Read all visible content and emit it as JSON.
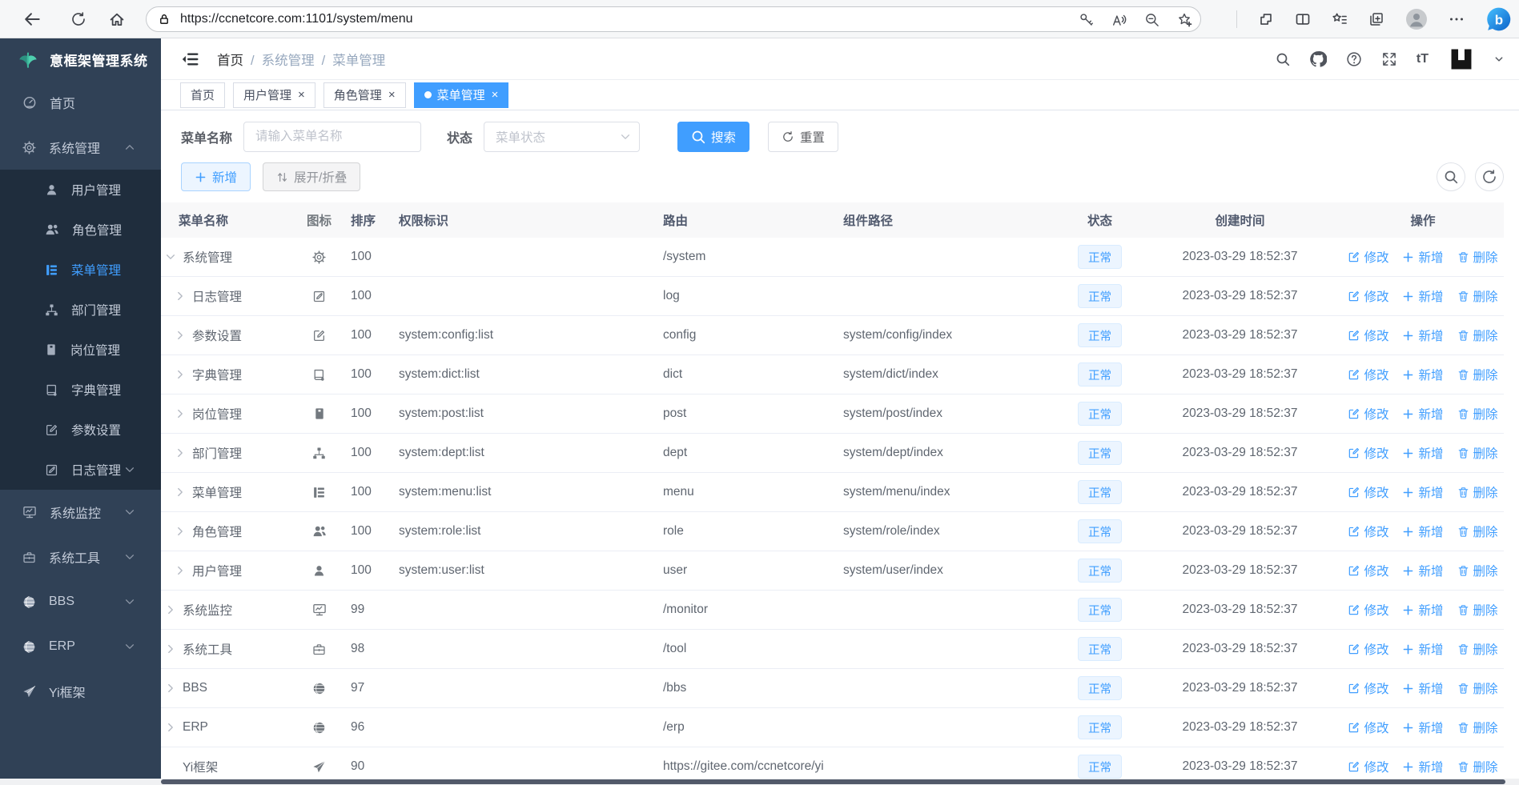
{
  "colors": {
    "accent": "#409eff",
    "sidebar_bg": "#304156",
    "submenu_bg": "#1f2d3d",
    "tag_bg": "#ecf5ff",
    "tab_active_bg": "#409eff",
    "logo_green": "#3fbf9c"
  },
  "browser": {
    "url": "https://ccnetcore.com:1101/system/menu",
    "left_icons": [
      "back-icon",
      "refresh-icon",
      "home-icon"
    ],
    "pill_left_icon": "lock-icon",
    "pill_right_icons": [
      "key-icon",
      "read-aloud-icon",
      "zoom-out-icon",
      "favorite-add-icon"
    ],
    "right_icons": [
      "extensions-icon",
      "split-screen-icon",
      "favorites-bar-icon",
      "collections-icon",
      "profile-icon",
      "more-icon",
      "bing-icon"
    ]
  },
  "sidebar": {
    "logo_text": "意框架管理系统",
    "logo_icon": "leaf-logo-icon",
    "items": [
      {
        "label": "首页",
        "icon": "dashboard-icon",
        "caret": null,
        "active": false
      },
      {
        "label": "系统管理",
        "icon": "gear-icon",
        "caret": "chevron-up-icon",
        "active": false,
        "children": [
          {
            "label": "用户管理",
            "icon": "user-icon",
            "caret": null,
            "active": false
          },
          {
            "label": "角色管理",
            "icon": "role-icon",
            "caret": null,
            "active": false
          },
          {
            "label": "菜单管理",
            "icon": "menu-icon",
            "caret": null,
            "active": true
          },
          {
            "label": "部门管理",
            "icon": "dept-icon",
            "caret": null,
            "active": false
          },
          {
            "label": "岗位管理",
            "icon": "post-icon",
            "caret": null,
            "active": false
          },
          {
            "label": "字典管理",
            "icon": "dict-icon",
            "caret": null,
            "active": false
          },
          {
            "label": "参数设置",
            "icon": "config-icon",
            "caret": null,
            "active": false
          },
          {
            "label": "日志管理",
            "icon": "log-icon",
            "caret": "chevron-down-icon",
            "active": false
          }
        ]
      },
      {
        "label": "系统监控",
        "icon": "monitor-icon",
        "caret": "chevron-down-icon",
        "active": false
      },
      {
        "label": "系统工具",
        "icon": "tool-icon",
        "caret": "chevron-down-icon",
        "active": false
      },
      {
        "label": "BBS",
        "icon": "globe-icon",
        "caret": "chevron-down-icon",
        "active": false
      },
      {
        "label": "ERP",
        "icon": "globe-icon",
        "caret": "chevron-down-icon",
        "active": false
      },
      {
        "label": "Yi框架",
        "icon": "plane-icon",
        "caret": null,
        "active": false
      }
    ]
  },
  "header": {
    "breadcrumb": [
      "首页",
      "系统管理",
      "菜单管理"
    ],
    "action_icons": [
      "search-icon",
      "github-icon",
      "help-icon",
      "fullscreen-icon",
      "font-size-icon"
    ],
    "avatar_icon": "user-avatar-logo-icon",
    "avatar_caret": "caret-down-icon"
  },
  "tabs": [
    {
      "label": "首页",
      "closable": false,
      "active": false
    },
    {
      "label": "用户管理",
      "closable": true,
      "active": false
    },
    {
      "label": "角色管理",
      "closable": true,
      "active": false
    },
    {
      "label": "菜单管理",
      "closable": true,
      "active": true
    }
  ],
  "filters": {
    "name_label": "菜单名称",
    "name_placeholder": "请输入菜单名称",
    "name_value": "",
    "status_label": "状态",
    "status_placeholder": "菜单状态",
    "search_label": "搜索",
    "reset_label": "重置"
  },
  "toolbar": {
    "add_label": "新增",
    "expand_label": "展开/折叠"
  },
  "table": {
    "columns": [
      "菜单名称",
      "图标",
      "排序",
      "权限标识",
      "路由",
      "组件路径",
      "状态",
      "创建时间",
      "操作"
    ],
    "op_labels": [
      "修改",
      "新增",
      "删除"
    ],
    "op_icons": [
      "edit-icon",
      "plus-icon",
      "trash-icon"
    ],
    "rows": [
      {
        "name": "系统管理",
        "icon": "gear-icon",
        "level": 0,
        "expand": "expanded",
        "sort": "100",
        "perm": "",
        "route": "/system",
        "component": "",
        "status": "正常",
        "created": "2023-03-29 18:52:37"
      },
      {
        "name": "日志管理",
        "icon": "log-icon",
        "level": 1,
        "expand": "collapsed",
        "sort": "100",
        "perm": "",
        "route": "log",
        "component": "",
        "status": "正常",
        "created": "2023-03-29 18:52:37"
      },
      {
        "name": "参数设置",
        "icon": "config-icon",
        "level": 1,
        "expand": "collapsed",
        "sort": "100",
        "perm": "system:config:list",
        "route": "config",
        "component": "system/config/index",
        "status": "正常",
        "created": "2023-03-29 18:52:37"
      },
      {
        "name": "字典管理",
        "icon": "dict-icon",
        "level": 1,
        "expand": "collapsed",
        "sort": "100",
        "perm": "system:dict:list",
        "route": "dict",
        "component": "system/dict/index",
        "status": "正常",
        "created": "2023-03-29 18:52:37"
      },
      {
        "name": "岗位管理",
        "icon": "post-icon",
        "level": 1,
        "expand": "collapsed",
        "sort": "100",
        "perm": "system:post:list",
        "route": "post",
        "component": "system/post/index",
        "status": "正常",
        "created": "2023-03-29 18:52:37"
      },
      {
        "name": "部门管理",
        "icon": "dept-icon",
        "level": 1,
        "expand": "collapsed",
        "sort": "100",
        "perm": "system:dept:list",
        "route": "dept",
        "component": "system/dept/index",
        "status": "正常",
        "created": "2023-03-29 18:52:37"
      },
      {
        "name": "菜单管理",
        "icon": "menu-icon",
        "level": 1,
        "expand": "collapsed",
        "sort": "100",
        "perm": "system:menu:list",
        "route": "menu",
        "component": "system/menu/index",
        "status": "正常",
        "created": "2023-03-29 18:52:37"
      },
      {
        "name": "角色管理",
        "icon": "role-icon",
        "level": 1,
        "expand": "collapsed",
        "sort": "100",
        "perm": "system:role:list",
        "route": "role",
        "component": "system/role/index",
        "status": "正常",
        "created": "2023-03-29 18:52:37"
      },
      {
        "name": "用户管理",
        "icon": "user-icon",
        "level": 1,
        "expand": "collapsed",
        "sort": "100",
        "perm": "system:user:list",
        "route": "user",
        "component": "system/user/index",
        "status": "正常",
        "created": "2023-03-29 18:52:37"
      },
      {
        "name": "系统监控",
        "icon": "monitor-icon",
        "level": 0,
        "expand": "collapsed",
        "sort": "99",
        "perm": "",
        "route": "/monitor",
        "component": "",
        "status": "正常",
        "created": "2023-03-29 18:52:37"
      },
      {
        "name": "系统工具",
        "icon": "tool-icon",
        "level": 0,
        "expand": "collapsed",
        "sort": "98",
        "perm": "",
        "route": "/tool",
        "component": "",
        "status": "正常",
        "created": "2023-03-29 18:52:37"
      },
      {
        "name": "BBS",
        "icon": "globe-icon",
        "level": 0,
        "expand": "collapsed",
        "sort": "97",
        "perm": "",
        "route": "/bbs",
        "component": "",
        "status": "正常",
        "created": "2023-03-29 18:52:37"
      },
      {
        "name": "ERP",
        "icon": "globe-icon",
        "level": 0,
        "expand": "collapsed",
        "sort": "96",
        "perm": "",
        "route": "/erp",
        "component": "",
        "status": "正常",
        "created": "2023-03-29 18:52:37"
      },
      {
        "name": "Yi框架",
        "icon": "plane-icon",
        "level": 0,
        "expand": "leaf",
        "sort": "90",
        "perm": "",
        "route": "https://gitee.com/ccnetcore/yi",
        "component": "",
        "status": "正常",
        "created": "2023-03-29 18:52:37"
      }
    ]
  }
}
